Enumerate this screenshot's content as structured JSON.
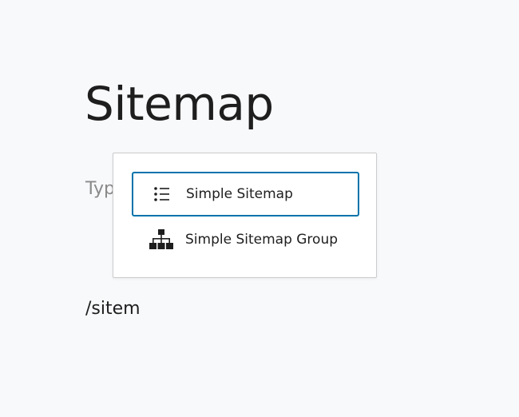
{
  "page": {
    "title": "Sitemap",
    "placeholder": "Typ",
    "slash_input": "/sitem"
  },
  "autocomplete": {
    "items": [
      {
        "label": "Simple Sitemap",
        "icon": "list-icon",
        "selected": true
      },
      {
        "label": "Simple Sitemap Group",
        "icon": "sitemap-icon",
        "selected": false
      }
    ]
  },
  "colors": {
    "accent": "#0073aa",
    "background": "#f8f9fb",
    "text": "#1e1e1e",
    "placeholder": "#8a8a8a"
  }
}
